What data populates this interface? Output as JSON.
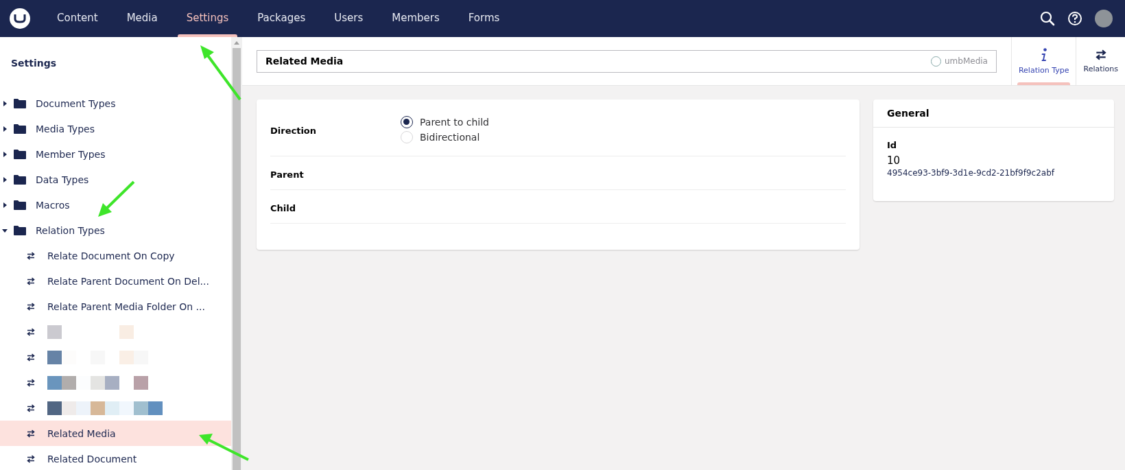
{
  "top_nav": {
    "sections": [
      {
        "label": "Content",
        "selected": false
      },
      {
        "label": "Media",
        "selected": false
      },
      {
        "label": "Settings",
        "selected": true
      },
      {
        "label": "Packages",
        "selected": false
      },
      {
        "label": "Users",
        "selected": false
      },
      {
        "label": "Members",
        "selected": false
      },
      {
        "label": "Forms",
        "selected": false
      }
    ]
  },
  "sidebar": {
    "title": "Settings",
    "items": [
      {
        "label": "Document Types",
        "expanded": false
      },
      {
        "label": "Media Types",
        "expanded": false
      },
      {
        "label": "Member Types",
        "expanded": false
      },
      {
        "label": "Data Types",
        "expanded": false
      },
      {
        "label": "Macros",
        "expanded": false
      },
      {
        "label": "Relation Types",
        "expanded": true,
        "children": [
          {
            "kind": "item",
            "label": "Relate Document On Copy",
            "selected": false
          },
          {
            "kind": "item",
            "label": "Relate Parent Document On Del...",
            "selected": false
          },
          {
            "kind": "item",
            "label": "Relate Parent Media Folder On ...",
            "selected": false
          },
          {
            "kind": "redacted",
            "selected": false
          },
          {
            "kind": "redacted",
            "selected": false
          },
          {
            "kind": "redacted",
            "selected": false
          },
          {
            "kind": "redacted",
            "selected": false
          },
          {
            "kind": "item",
            "label": "Related Media",
            "selected": true
          },
          {
            "kind": "item",
            "label": "Related Document",
            "selected": false
          }
        ]
      }
    ]
  },
  "editor": {
    "name": "Related Media",
    "alias": "umbMedia",
    "apps": [
      {
        "label": "Relation Type",
        "kind": "info",
        "selected": true
      },
      {
        "label": "Relations",
        "kind": "relations",
        "selected": false
      }
    ],
    "properties": [
      {
        "label": "Direction",
        "kind": "radio",
        "options": [
          {
            "label": "Parent to child",
            "selected": true
          },
          {
            "label": "Bidirectional",
            "selected": false
          }
        ]
      },
      {
        "label": "Parent",
        "kind": "empty"
      },
      {
        "label": "Child",
        "kind": "empty"
      }
    ],
    "general": {
      "title": "General",
      "id_label": "Id",
      "id": "10",
      "key": "4954ce93-3bf9-3d1e-9cd2-21bf9f9c2abf"
    }
  }
}
